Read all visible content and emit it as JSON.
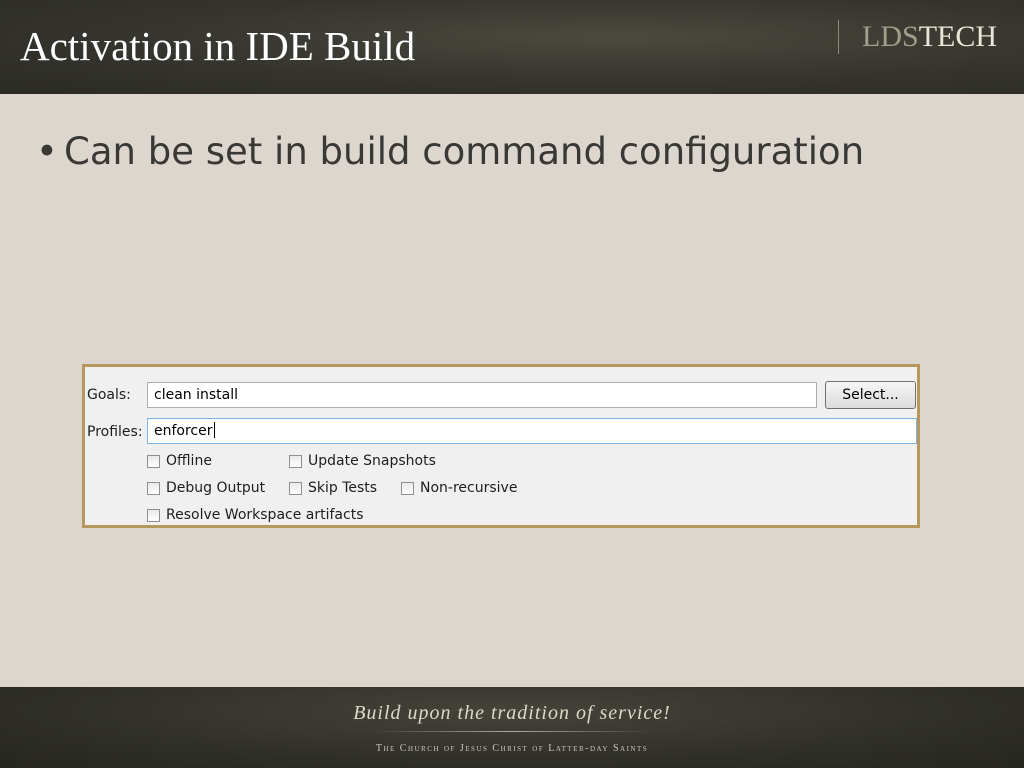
{
  "slide": {
    "title": "Activation in IDE Build",
    "logo": {
      "part1": "LDS",
      "part2": "TECH"
    },
    "bullet": "Can be set in build command configuration"
  },
  "dialog": {
    "goals_label": "Goals:",
    "goals_value": "clean install",
    "select_button": "Select...",
    "profiles_label": "Profiles:",
    "profiles_value": "enforcer",
    "checkboxes": {
      "offline": {
        "label": "Offline",
        "checked": false
      },
      "update_snapshots": {
        "label": "Update Snapshots",
        "checked": false
      },
      "debug_output": {
        "label": "Debug Output",
        "checked": false
      },
      "skip_tests": {
        "label": "Skip Tests",
        "checked": false
      },
      "non_recursive": {
        "label": "Non-recursive",
        "checked": false
      },
      "resolve_workspace": {
        "label": "Resolve Workspace artifacts",
        "checked": false
      }
    }
  },
  "footer": {
    "tagline": "Build upon the tradition of service!",
    "church": "The Church of Jesus Christ of Latter-day Saints"
  },
  "colors": {
    "header_bg": "#35342d",
    "slide_bg": "#ddd6cf",
    "panel_border": "#b5985e",
    "focus_border": "#7eb4ea"
  }
}
